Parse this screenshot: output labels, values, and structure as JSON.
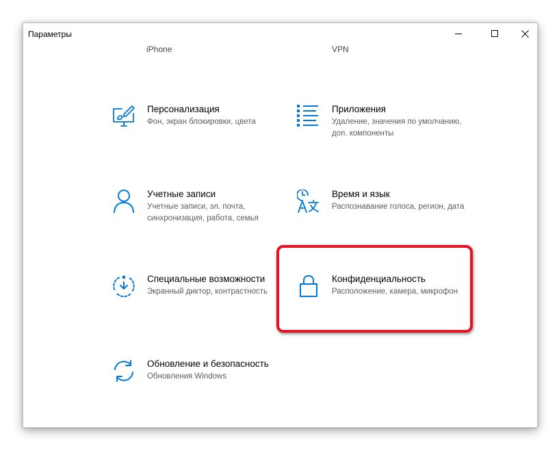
{
  "window": {
    "title": "Параметры"
  },
  "partial_row": {
    "left_label": "iPhone",
    "right_label": "VPN"
  },
  "tiles": {
    "personalization": {
      "title": "Персонализация",
      "desc": "Фон, экран блокировки, цвета",
      "icon": "paintbrush-screen-icon"
    },
    "apps": {
      "title": "Приложения",
      "desc": "Удаление, значения по умолчанию, доп. компоненты",
      "icon": "apps-list-icon"
    },
    "accounts": {
      "title": "Учетные записи",
      "desc": "Учетные записи, эл. почта, синхронизация, работа, семья",
      "icon": "person-icon"
    },
    "time_language": {
      "title": "Время и язык",
      "desc": "Распознавание голоса, регион, дата",
      "icon": "time-language-icon"
    },
    "accessibility": {
      "title": "Специальные возможности",
      "desc": "Экранный диктор, контрастность",
      "icon": "ease-of-access-icon"
    },
    "privacy": {
      "title": "Конфиденциальность",
      "desc": "Расположение, камера, микрофон",
      "icon": "lock-icon"
    },
    "update_security": {
      "title": "Обновление и безопасность",
      "desc": "Обновления Windows",
      "icon": "sync-arrows-icon"
    }
  },
  "colors": {
    "accent": "#0078d7",
    "highlight_border": "#e81123",
    "description_text": "#5d5d5d"
  }
}
